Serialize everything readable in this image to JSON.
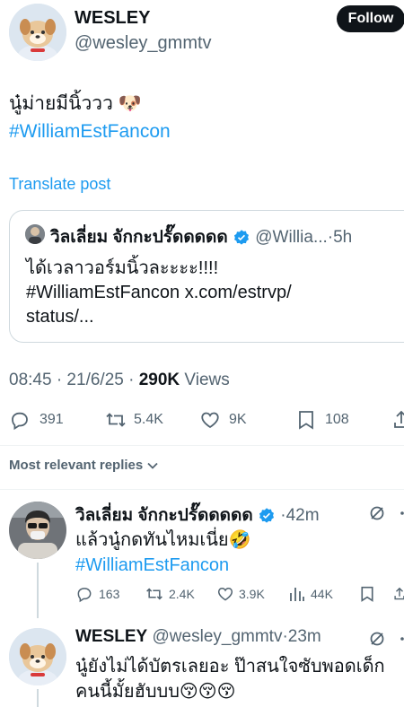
{
  "author": {
    "name": "WESLEY",
    "handle": "@wesley_gmmtv",
    "follow_label": "Follow"
  },
  "post": {
    "text": "นู๋ม่ายมีนิ้ววว 🐶",
    "hashtag": "#WilliamEstFancon",
    "translate_label": "Translate post"
  },
  "quote": {
    "name": "วิลเลี่ยม จักกะปรั๊ดดดดด",
    "handle": "@Willia...",
    "time": "·5h",
    "line1": "ได้เวลาวอร์มนิ้วละะะะ!!!!",
    "line2": "#WilliamEstFancon x.com/estrvp/",
    "line3": "status/..."
  },
  "meta": {
    "timestamp": "08:45 · 21/6/25 · ",
    "views_count": "290K",
    "views_label": " Views"
  },
  "stats": {
    "replies": "391",
    "reposts": "5.4K",
    "likes": "9K",
    "bookmarks": "108"
  },
  "replies_filter": "Most relevant replies",
  "replies": [
    {
      "name": "วิลเลี่ยม จักกะปรั๊ดดดดด",
      "handle": "",
      "time": "·42m",
      "text": "แล้วนู๋กดทันไหมเนี่ย🤣",
      "hashtag": "#WilliamEstFancon",
      "stats": {
        "replies": "163",
        "reposts": "2.4K",
        "likes": "3.9K",
        "views": "44K"
      }
    },
    {
      "name": "WESLEY",
      "handle": "@wesley_gmmtv",
      "time": "·23m",
      "line1": "นู๋ยังไม่ได้บัตรเลยอะ ป๊าสนใจซับพอดเด็ก",
      "line2": "คนนี้มั้ยฮับบบ😚😚😚"
    }
  ],
  "colors": {
    "link": "#1d9bf0",
    "verified": "#1d9bf0",
    "secondary_text": "#536471"
  }
}
